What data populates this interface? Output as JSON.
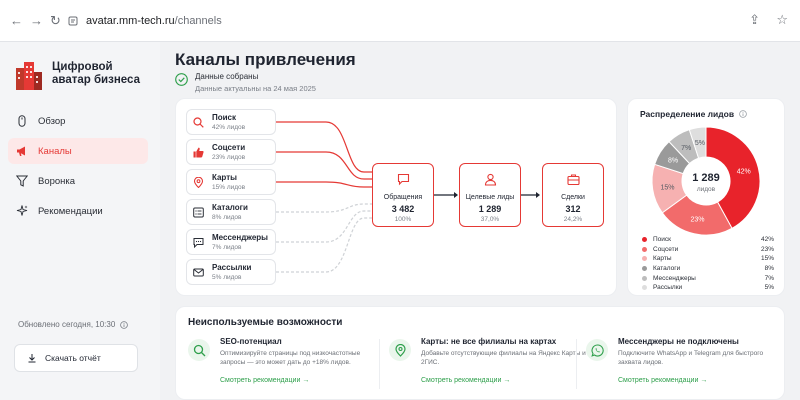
{
  "browser": {
    "domain": "avatar.mm-tech.ru",
    "path": "/channels"
  },
  "brand": {
    "line1": "Цифровой",
    "line2": "аватар бизнеса"
  },
  "nav": [
    {
      "label": "Обзор",
      "icon": "mouse-icon",
      "active": false
    },
    {
      "label": "Каналы",
      "icon": "megaphone-icon",
      "active": true
    },
    {
      "label": "Воронка",
      "icon": "funnel-icon",
      "active": false
    },
    {
      "label": "Рекомендации",
      "icon": "sparkle-icon",
      "active": false
    }
  ],
  "sidebar_footer": {
    "updated": "Обновлено сегодня, 10:30",
    "download_label": "Скачать отчёт"
  },
  "page": {
    "title": "Каналы привлечения",
    "status_main": "Данные собраны",
    "status_sub": "Данные актуальны на 24 мая 2025"
  },
  "sources": [
    {
      "name": "Поиск",
      "share": "42% лидов",
      "icon": "search-icon",
      "active": true
    },
    {
      "name": "Соцсети",
      "share": "23% лидов",
      "icon": "thumbs-up-icon",
      "active": true
    },
    {
      "name": "Карты",
      "share": "15% лидов",
      "icon": "map-pin-icon",
      "active": true
    },
    {
      "name": "Каталоги",
      "share": "8% лидов",
      "icon": "catalog-icon",
      "active": false
    },
    {
      "name": "Мессенджеры",
      "share": "7% лидов",
      "icon": "chat-icon",
      "active": false
    },
    {
      "name": "Рассылки",
      "share": "5% лидов",
      "icon": "mail-icon",
      "active": false
    }
  ],
  "stages": [
    {
      "label": "Обращения",
      "value": "3 482",
      "pct": "100%",
      "icon": "message-icon"
    },
    {
      "label": "Целевые лиды",
      "value": "1 289",
      "pct": "37,0%",
      "icon": "user-icon"
    },
    {
      "label": "Сделки",
      "value": "312",
      "pct": "24,2%",
      "icon": "briefcase-icon"
    }
  ],
  "distribution": {
    "title": "Распределение лидов",
    "total": "1 289",
    "total_label": "лидов"
  },
  "chart_data": {
    "type": "pie",
    "categories": [
      "Поиск",
      "Соцсети",
      "Карты",
      "Каталоги",
      "Мессенджеры",
      "Рассылки"
    ],
    "values": [
      42,
      23,
      15,
      8,
      7,
      5
    ],
    "labels": [
      "42%",
      "23%",
      "15%",
      "8%",
      "7%",
      "5%"
    ],
    "colors": [
      "#e8232b",
      "#f26b6b",
      "#f6b1b1",
      "#9a9a9a",
      "#bdbdbd",
      "#dedede"
    ]
  },
  "unused": {
    "title": "Неиспользуемые возможности",
    "items": [
      {
        "title": "SEO-потенциал",
        "desc": "Оптимизируйте страницы под низкочастотные запросы — это может дать до +18% лидов.",
        "link": "Смотреть рекомендации",
        "icon": "search-icon"
      },
      {
        "title": "Карты: не все филиалы на картах",
        "desc": "Добавьте отсутствующие филиалы на Яндекс Карты и 2ГИС.",
        "link": "Смотреть рекомендации",
        "icon": "map-pin-icon"
      },
      {
        "title": "Мессенджеры не подключены",
        "desc": "Подключите WhatsApp и Telegram для быстрого захвата лидов.",
        "link": "Смотреть рекомендации",
        "icon": "whatsapp-icon"
      }
    ]
  }
}
